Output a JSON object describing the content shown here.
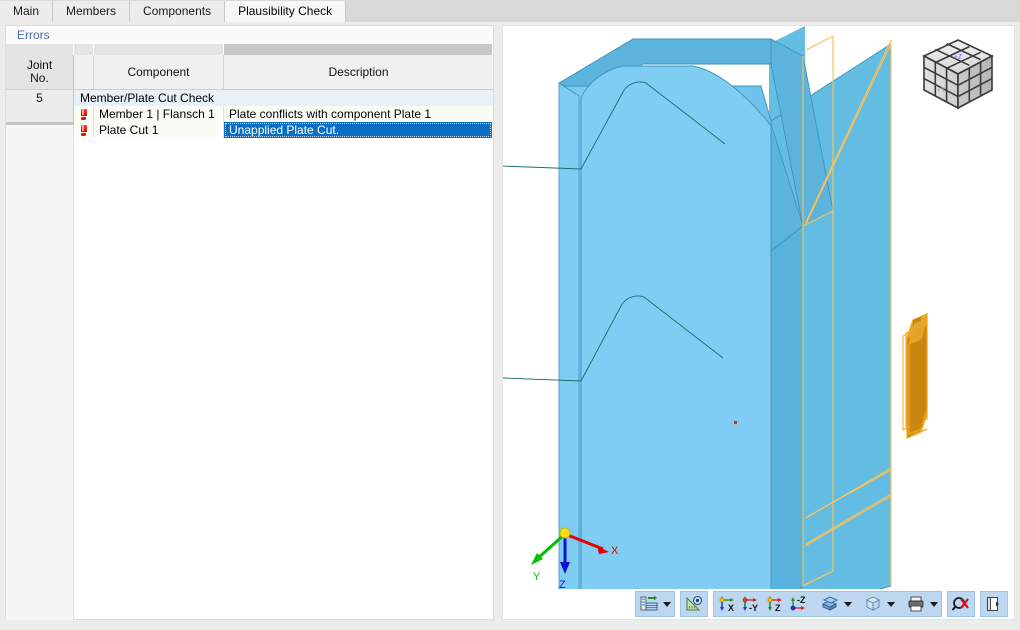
{
  "tabs": [
    {
      "label": "Main",
      "active": false
    },
    {
      "label": "Members",
      "active": false
    },
    {
      "label": "Components",
      "active": false
    },
    {
      "label": "Plausibility Check",
      "active": true
    }
  ],
  "panel": {
    "section_title": "Errors",
    "columns": [
      {
        "label": "Joint\nNo.",
        "line1": "Joint",
        "line2": "No."
      },
      {
        "label": ""
      },
      {
        "label": "Component"
      },
      {
        "label": "Description"
      }
    ],
    "rows": [
      {
        "type": "group",
        "joint_no": "5",
        "group_label": "Member/Plate Cut Check"
      },
      {
        "type": "error",
        "joint_no": "",
        "icon": "error-exclamation-icon",
        "component": "Member 1 | Flansch 1",
        "description": "Plate conflicts with component Plate 1",
        "selected": false
      },
      {
        "type": "error",
        "joint_no": "",
        "icon": "error-exclamation-icon",
        "component": "Plate Cut 1",
        "description": "Unapplied Plate Cut.",
        "selected": true
      }
    ]
  },
  "viewport": {
    "axes": {
      "x_label": "X",
      "y_label": "Y",
      "z_label": "Z",
      "x_color": "#e60000",
      "y_color": "#00c000",
      "z_color": "#1010d0"
    },
    "viewcube": {
      "top_face_label": "+Z",
      "front_face_label": "+Y"
    },
    "colors": {
      "member_light": "#7fcdf2",
      "member_mid": "#5bb6e0",
      "member_dark": "#4aa3cf",
      "plate_fill": "#cf8715",
      "plate_edge": "#f2a51e",
      "wireframe": "#fcc257",
      "marker_red": "#ee2020"
    },
    "toolbar": [
      {
        "group": [
          {
            "name": "rendering-settings-icon",
            "has_dropdown": true
          }
        ]
      },
      {
        "group": [
          {
            "name": "measure-view-icon",
            "has_dropdown": false
          }
        ]
      },
      {
        "group": [
          {
            "name": "view-in-x-icon",
            "label": "X",
            "has_dropdown": false
          },
          {
            "name": "view-in-minus-y-icon",
            "label": "-Y",
            "has_dropdown": false
          },
          {
            "name": "view-in-z-icon",
            "label": "Z",
            "has_dropdown": false
          },
          {
            "name": "view-in-minus-z-icon",
            "label": "-Z",
            "has_dropdown": false
          },
          {
            "name": "render-mode-icon",
            "has_dropdown": true
          },
          {
            "name": "wireframe-box-icon",
            "has_dropdown": true
          },
          {
            "name": "print-icon",
            "has_dropdown": true
          }
        ]
      },
      {
        "group": [
          {
            "name": "zoom-reset-icon",
            "has_dropdown": false
          }
        ]
      },
      {
        "group": [
          {
            "name": "panel-toggle-icon",
            "has_dropdown": false
          }
        ]
      }
    ]
  }
}
